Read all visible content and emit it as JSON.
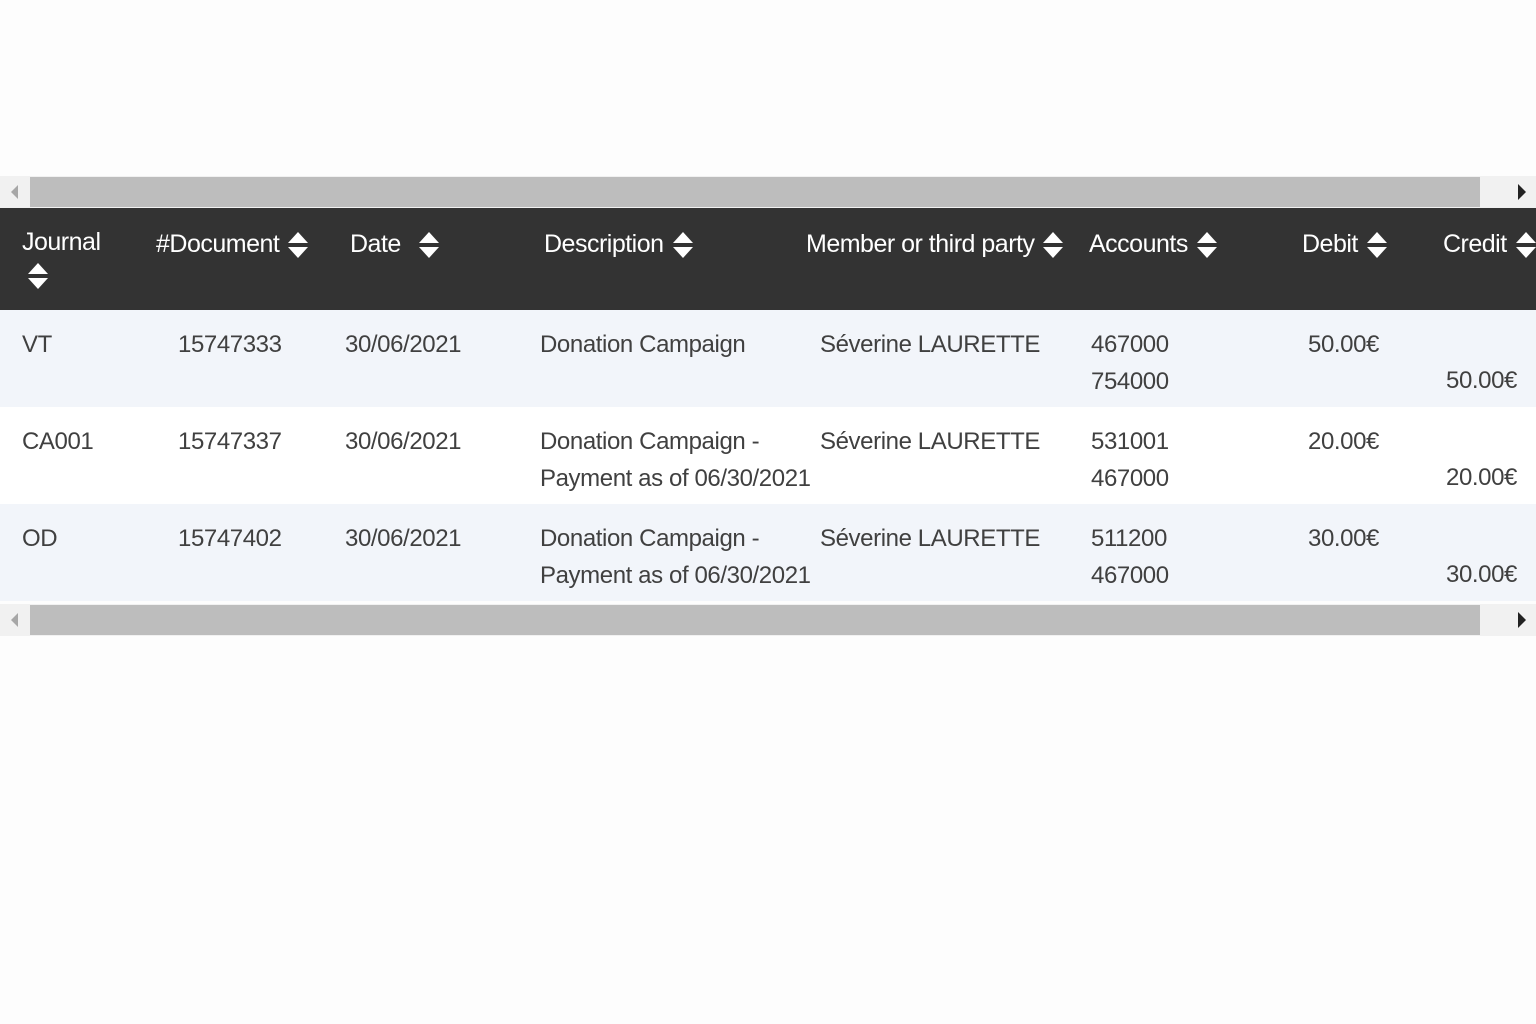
{
  "table": {
    "columns": [
      {
        "key": "journal",
        "label": "Journal"
      },
      {
        "key": "document",
        "label": "#Document"
      },
      {
        "key": "date",
        "label": "Date"
      },
      {
        "key": "description",
        "label": "Description"
      },
      {
        "key": "member",
        "label": "Member or third party"
      },
      {
        "key": "accounts",
        "label": "Accounts"
      },
      {
        "key": "debit",
        "label": "Debit"
      },
      {
        "key": "credit",
        "label": "Credit"
      }
    ],
    "rows": [
      {
        "journal": "VT",
        "document": "15747333",
        "date": "30/06/2021",
        "description": [
          "Donation Campaign",
          ""
        ],
        "member": "Séverine LAURETTE",
        "accounts": [
          "467000",
          "754000"
        ],
        "debit": "50.00€",
        "credit": "50.00€"
      },
      {
        "journal": "CA001",
        "document": "15747337",
        "date": "30/06/2021",
        "description": [
          "Donation Campaign -",
          "Payment as of 06/30/2021"
        ],
        "member": "Séverine LAURETTE",
        "accounts": [
          "531001",
          "467000"
        ],
        "debit": "20.00€",
        "credit": "20.00€"
      },
      {
        "journal": "OD",
        "document": "15747402",
        "date": "30/06/2021",
        "description": [
          "Donation Campaign -",
          "Payment as of 06/30/2021"
        ],
        "member": "Séverine LAURETTE",
        "accounts": [
          "511200",
          "467000"
        ],
        "debit": "30.00€",
        "credit": "30.00€"
      }
    ]
  },
  "colors": {
    "header_bg": "#333333",
    "row_alt_bg": "#f2f5fa",
    "scrollbar_thumb": "#bdbdbd"
  },
  "icons": {
    "sort": "sort-up-down-icon",
    "scroll_left": "scroll-left-arrow-icon",
    "scroll_right": "scroll-right-arrow-icon"
  }
}
